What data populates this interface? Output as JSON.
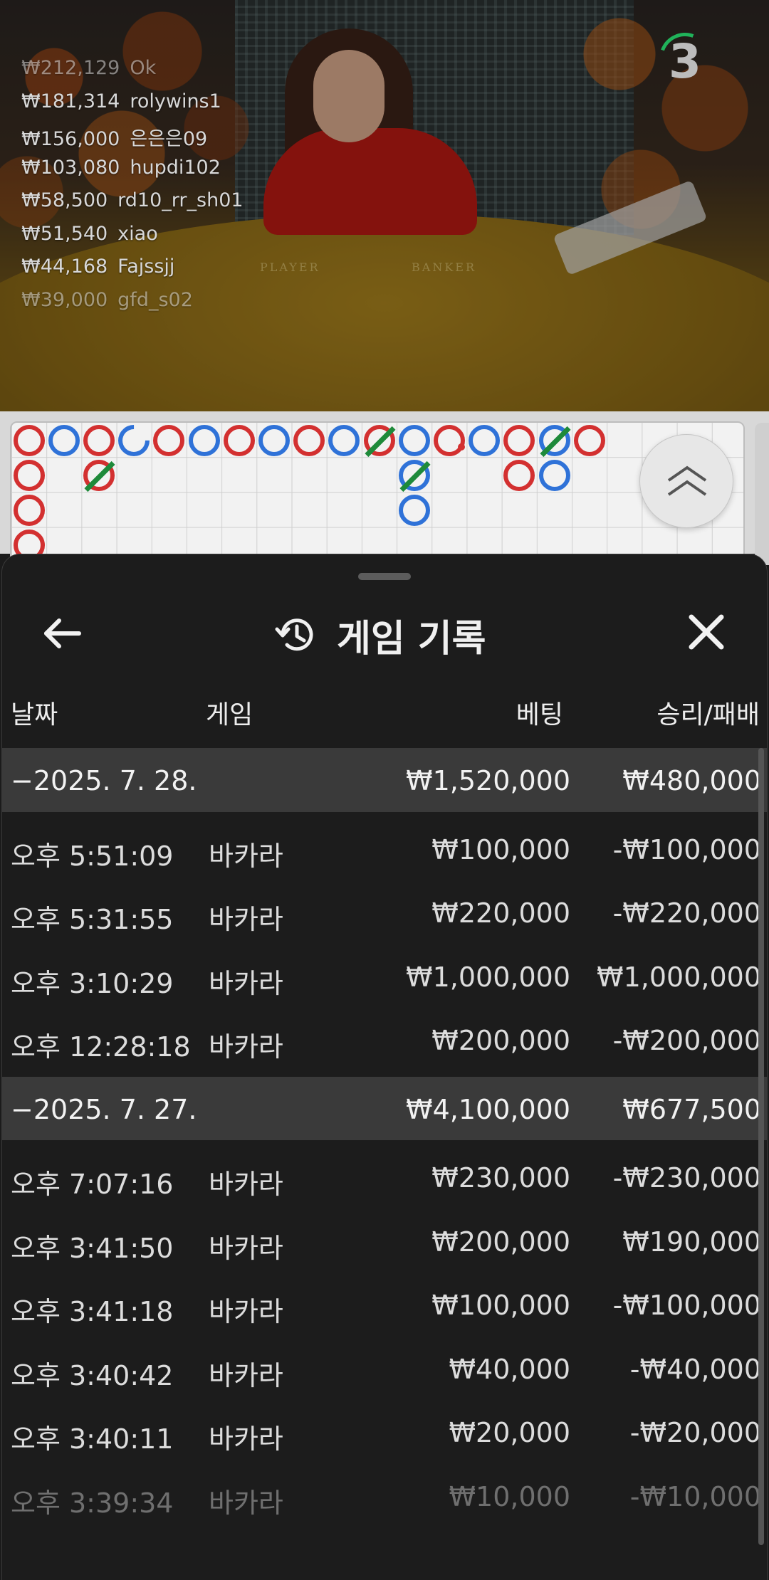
{
  "video": {
    "timer_value": "3",
    "table_labels": {
      "player": "PLAYER",
      "banker": "BANKER"
    },
    "winners": [
      {
        "amount": "₩212,129",
        "name": "Ok"
      },
      {
        "amount": "₩181,314",
        "name": "rolywins1"
      },
      {
        "amount": "₩156,000",
        "name": "은은은09"
      },
      {
        "amount": "₩103,080",
        "name": "hupdi102"
      },
      {
        "amount": "₩58,500",
        "name": "rd10_rr_sh01"
      },
      {
        "amount": "₩51,540",
        "name": "xiao"
      },
      {
        "amount": "₩44,168",
        "name": "Fajssjj"
      },
      {
        "amount": "₩39,000",
        "name": "gfd_s02"
      }
    ]
  },
  "bead_road": {
    "colors": {
      "banker": "#d33030",
      "player": "#2f72d8",
      "tie": "#1e8a3a"
    },
    "columns": [
      [
        "B",
        "B",
        "B",
        "B"
      ],
      [
        "P"
      ],
      [
        "B",
        "B-tie"
      ],
      [
        "P-open"
      ],
      [
        "B"
      ],
      [
        "P"
      ],
      [
        "B"
      ],
      [
        "P"
      ],
      [
        "B"
      ],
      [
        "P"
      ],
      [
        "B-tie"
      ],
      [
        "P",
        "P-tie",
        "P"
      ],
      [
        "B-dot"
      ],
      [
        "P"
      ],
      [
        "B",
        "B"
      ],
      [
        "P-tie",
        "P"
      ],
      [
        "B"
      ]
    ]
  },
  "sheet": {
    "title": "게임 기록",
    "columns": {
      "date": "날짜",
      "game": "게임",
      "bet": "베팅",
      "result": "승리/패배"
    },
    "groups": [
      {
        "date": "−2025. 7. 28.",
        "bet_total": "₩1,520,000",
        "result_total": "₩480,000",
        "rows": [
          {
            "time": "오후 5:51:09",
            "game": "바카라",
            "bet": "₩100,000",
            "result": "-₩100,000"
          },
          {
            "time": "오후 5:31:55",
            "game": "바카라",
            "bet": "₩220,000",
            "result": "-₩220,000"
          },
          {
            "time": "오후 3:10:29",
            "game": "바카라",
            "bet": "₩1,000,000",
            "result": "₩1,000,000"
          },
          {
            "time": "오후 12:28:18",
            "game": "바카라",
            "bet": "₩200,000",
            "result": "-₩200,000"
          }
        ]
      },
      {
        "date": "−2025. 7. 27.",
        "bet_total": "₩4,100,000",
        "result_total": "₩677,500",
        "rows": [
          {
            "time": "오후 7:07:16",
            "game": "바카라",
            "bet": "₩230,000",
            "result": "-₩230,000"
          },
          {
            "time": "오후 3:41:50",
            "game": "바카라",
            "bet": "₩200,000",
            "result": "₩190,000"
          },
          {
            "time": "오후 3:41:18",
            "game": "바카라",
            "bet": "₩100,000",
            "result": "-₩100,000"
          },
          {
            "time": "오후 3:40:42",
            "game": "바카라",
            "bet": "₩40,000",
            "result": "-₩40,000"
          },
          {
            "time": "오후 3:40:11",
            "game": "바카라",
            "bet": "₩20,000",
            "result": "-₩20,000"
          },
          {
            "time": "오후 3:39:34",
            "game": "바카라",
            "bet": "₩10,000",
            "result": "-₩10,000"
          }
        ]
      }
    ]
  }
}
